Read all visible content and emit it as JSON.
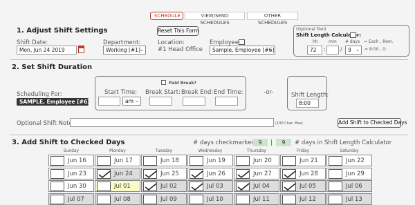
{
  "tabs": [
    {
      "label": "SCHEDULE",
      "active": true
    },
    {
      "label": "VIEW/SEND SCHEDULES",
      "active": false
    },
    {
      "label": "OTHER SCHEDULES",
      "active": false
    }
  ],
  "section1": {
    "title": "1. Adjust Shift Settings",
    "reset_label": "Reset This Form",
    "shift_date_label": "Shift Date:",
    "shift_date_value": "Mon, Jun 24 2019",
    "department_label": "Department:",
    "department_value": "Working [#1]",
    "location_label": "Location:",
    "location_value": "#1 Head Office",
    "employee_label": "Employee:",
    "employee_value": "Sample, Employee [#6]",
    "calculator": {
      "optional": "(Optional Tool)",
      "title": "Shift Length Calculator:",
      "hh": "hh",
      "mm": "mm",
      "days_head": "# days",
      "each": "= Each , Rem.",
      "hh_value": "72",
      "sep_colon": ":",
      "mm_value": "",
      "sep_slash": "/",
      "days_value": "9",
      "result": "= 8:00 , 0:"
    }
  },
  "section2": {
    "title": "2. Set Shift Duration",
    "scheduling_for_label": "Scheduling For:",
    "scheduling_for_value": "SAMPLE, Employee [#6]",
    "paid_break_label": "Paid Break?",
    "start_time_label": "Start Time:",
    "start_ampm": "am",
    "break_start_label": "Break Start:",
    "break_end_label": "Break End:",
    "end_time_label": "End Time:",
    "or_label": "-or-",
    "shift_length_label": "Shift Length:",
    "shift_length_value": "8:00",
    "note_label": "Optional Shift Note:",
    "note_max": "(100 Char. Max)",
    "add_button": "Add Shift to Checked Days"
  },
  "section3": {
    "title": "3. Add Shift to Checked Days",
    "checkmarked_label": "# days checkmarked:",
    "checkmarked_value": "9",
    "separator": "|",
    "calc_value": "9",
    "calc_label": "# days in Shift Length Calculator",
    "days_of_week": [
      "Sunday",
      "Monday",
      "Tuesday",
      "Wednesday",
      "Thursday",
      "Friday",
      "Saturday"
    ],
    "weeks": [
      [
        {
          "label": "Jun 16",
          "checked": false,
          "bg": "white"
        },
        {
          "label": "Jun 17",
          "checked": false,
          "bg": "white"
        },
        {
          "label": "Jun 18",
          "checked": false,
          "bg": "white"
        },
        {
          "label": "Jun 19",
          "checked": false,
          "bg": "white"
        },
        {
          "label": "Jun 20",
          "checked": false,
          "bg": "white"
        },
        {
          "label": "Jun 21",
          "checked": false,
          "bg": "white"
        },
        {
          "label": "Jun 22",
          "checked": false,
          "bg": "white"
        }
      ],
      [
        {
          "label": "Jun 23",
          "checked": false,
          "bg": "white"
        },
        {
          "label": "Jun 24",
          "checked": true,
          "bg": "gray"
        },
        {
          "label": "Jun 25",
          "checked": true,
          "bg": "white"
        },
        {
          "label": "Jun 26",
          "checked": true,
          "bg": "white"
        },
        {
          "label": "Jun 27",
          "checked": true,
          "bg": "white"
        },
        {
          "label": "Jun 28",
          "checked": true,
          "bg": "white"
        },
        {
          "label": "Jun 29",
          "checked": false,
          "bg": "white"
        }
      ],
      [
        {
          "label": "Jun 30",
          "checked": false,
          "bg": "white"
        },
        {
          "label": "Jul 01",
          "checked": false,
          "bg": "yellow"
        },
        {
          "label": "Jul 02",
          "checked": true,
          "bg": "gray"
        },
        {
          "label": "Jul 03",
          "checked": true,
          "bg": "gray"
        },
        {
          "label": "Jul 04",
          "checked": true,
          "bg": "gray"
        },
        {
          "label": "Jul 05",
          "checked": true,
          "bg": "gray"
        },
        {
          "label": "Jul 06",
          "checked": false,
          "bg": "gray"
        }
      ],
      [
        {
          "label": "Jul 07",
          "checked": false,
          "bg": "gray"
        },
        {
          "label": "Jul 08",
          "checked": false,
          "bg": "gray"
        },
        {
          "label": "Jul 09",
          "checked": false,
          "bg": "gray"
        },
        {
          "label": "Jul 10",
          "checked": false,
          "bg": "gray"
        },
        {
          "label": "Jul 11",
          "checked": false,
          "bg": "gray"
        },
        {
          "label": "Jul 12",
          "checked": false,
          "bg": "gray"
        },
        {
          "label": "Jul 13",
          "checked": false,
          "bg": "gray"
        }
      ]
    ]
  }
}
